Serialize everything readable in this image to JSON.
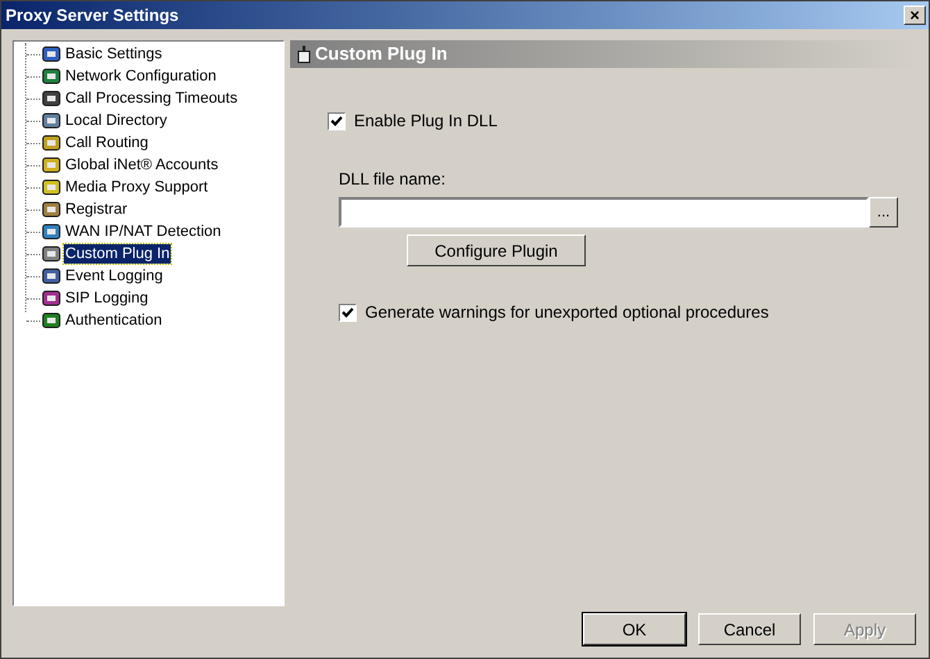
{
  "window": {
    "title": "Proxy Server Settings",
    "close": "×"
  },
  "tree": [
    {
      "label": "Basic Settings",
      "selected": false
    },
    {
      "label": "Network Configuration",
      "selected": false
    },
    {
      "label": "Call Processing Timeouts",
      "selected": false
    },
    {
      "label": "Local Directory",
      "selected": false
    },
    {
      "label": "Call Routing",
      "selected": false
    },
    {
      "label": "Global iNet® Accounts",
      "selected": false
    },
    {
      "label": "Media Proxy Support",
      "selected": false
    },
    {
      "label": "Registrar",
      "selected": false
    },
    {
      "label": "WAN IP/NAT Detection",
      "selected": false
    },
    {
      "label": "Custom Plug In",
      "selected": true
    },
    {
      "label": "Event Logging",
      "selected": false
    },
    {
      "label": "SIP Logging",
      "selected": false
    },
    {
      "label": "Authentication",
      "selected": false
    }
  ],
  "panel": {
    "title": "Custom Plug In",
    "enable": {
      "label": "Enable Plug In DLL",
      "checked": true
    },
    "dll_label": "DLL file name:",
    "browse": "...",
    "configure": "Configure Plugin",
    "warnings": {
      "label": "Generate warnings for unexported optional procedures",
      "checked": true
    }
  },
  "buttons": [
    {
      "label": "OK",
      "disabled": false,
      "default": true
    },
    {
      "label": "Cancel",
      "disabled": false,
      "default": false
    },
    {
      "label": "Apply",
      "disabled": true,
      "default": false
    }
  ]
}
